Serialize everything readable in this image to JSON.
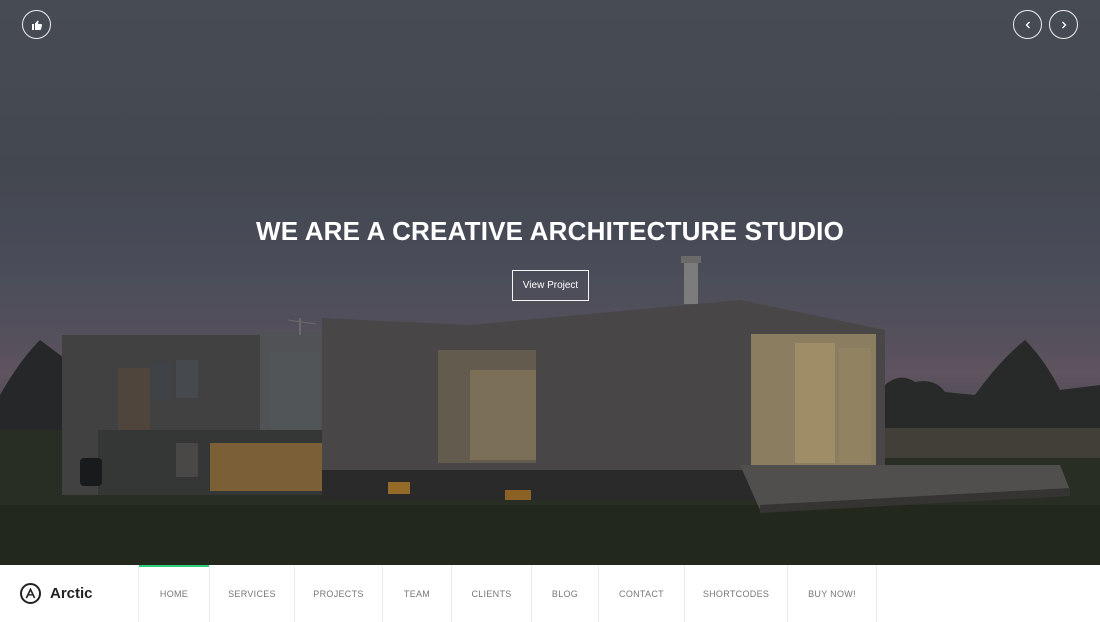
{
  "hero": {
    "title": "WE ARE A CREATIVE ARCHITECTURE STUDIO",
    "cta_label": "View Project"
  },
  "icons": {
    "like": "thumbs-up-icon",
    "prev": "chevron-left-icon",
    "next": "chevron-right-icon",
    "logo": "letter-a-circle-icon"
  },
  "brand": {
    "name": "Arctic"
  },
  "menu": {
    "items": [
      {
        "label": "HOME",
        "active": true
      },
      {
        "label": "SERVICES",
        "active": false
      },
      {
        "label": "PROJECTS",
        "active": false
      },
      {
        "label": "TEAM",
        "active": false
      },
      {
        "label": "CLIENTS",
        "active": false
      },
      {
        "label": "BLOG",
        "active": false
      },
      {
        "label": "CONTACT",
        "active": false
      },
      {
        "label": "SHORTCODES",
        "active": false
      },
      {
        "label": "BUY NOW!",
        "active": false
      }
    ]
  },
  "colors": {
    "accent": "#2bcf7a",
    "nav_bg": "#ffffff",
    "nav_text": "#777777"
  }
}
